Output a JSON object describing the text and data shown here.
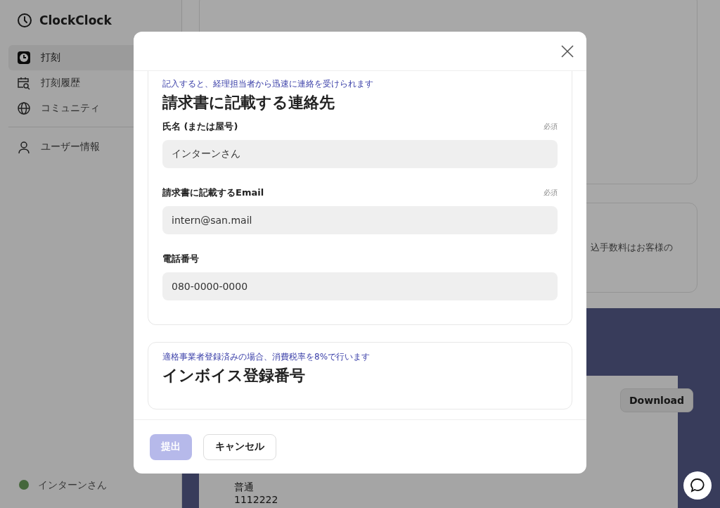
{
  "sidebar": {
    "brand": "ClockClock",
    "items": [
      {
        "label": "打刻",
        "selected": true
      },
      {
        "label": "打刻履歴",
        "selected": false
      },
      {
        "label": "コミュニティ",
        "selected": false
      }
    ],
    "secondary_items": [
      {
        "label": "ユーザー情報",
        "selected": false
      }
    ],
    "user": "インターンさん"
  },
  "main": {
    "note": "込手数料はお客様の",
    "download": "Download",
    "bank": [
      "普通",
      "1112222"
    ]
  },
  "modal": {
    "sections": [
      {
        "hint": "記入すると、経理担当者から迅速に連絡を受けられます",
        "title": "請求書に記載する連絡先",
        "fields": [
          {
            "label": "氏名 (または屋号)",
            "badge": "必須",
            "value": "インターンさん"
          },
          {
            "label": "請求書に記載するEmail",
            "badge": "必須",
            "value": "intern@san.mail"
          },
          {
            "label": "電話番号",
            "value": "080-0000-0000"
          }
        ]
      },
      {
        "hint": "適格事業者登録済みの場合、消費税率を8%で行います",
        "title": "インボイス登録番号"
      }
    ],
    "buttons": [
      {
        "label": "提出",
        "kind": "primary",
        "disabled": true
      },
      {
        "label": "キャンセル",
        "kind": "secondary",
        "disabled": false
      }
    ]
  }
}
